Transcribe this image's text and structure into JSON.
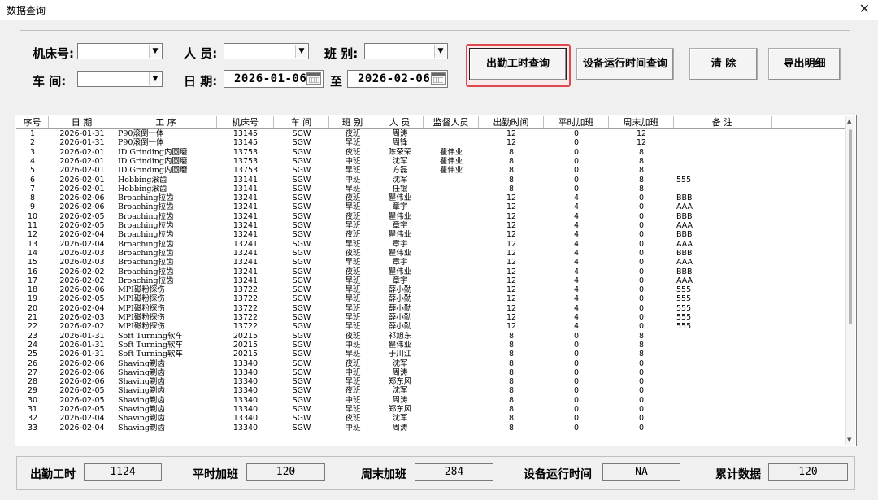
{
  "window": {
    "title": "数据查询",
    "close_glyph": "✕"
  },
  "filters": {
    "machine_label": "机床号:",
    "person_label": "人 员:",
    "shift_label": "班 别:",
    "workshop_label": "车 间:",
    "date_label": "日 期:",
    "to_label": "至",
    "machine_value": "",
    "person_value": "",
    "shift_value": "",
    "workshop_value": "",
    "date_from": "2026-01-06",
    "date_to": "2026-02-06"
  },
  "buttons": {
    "attendance_query": "出勤工时查询",
    "equipment_query": "设备运行时间查询",
    "clear": "清 除",
    "export": "导出明细"
  },
  "table": {
    "columns": [
      "序号",
      "日 期",
      "工 序",
      "机床号",
      "车 间",
      "班 别",
      "人 员",
      "监督人员",
      "出勤时间",
      "平时加班",
      "周末加班",
      "备 注"
    ],
    "rows": [
      [
        "1",
        "2026-01-31",
        "P90滚倒一体",
        "13145",
        "SGW",
        "夜班",
        "周涛",
        "",
        "12",
        "0",
        "12",
        ""
      ],
      [
        "2",
        "2026-01-31",
        "P90滚倒一体",
        "13145",
        "SGW",
        "早班",
        "周锋",
        "",
        "12",
        "0",
        "12",
        ""
      ],
      [
        "3",
        "2026-02-01",
        "ID Grinding内圆磨",
        "13753",
        "SGW",
        "夜班",
        "陈荣荣",
        "瞿伟业",
        "8",
        "0",
        "8",
        ""
      ],
      [
        "4",
        "2026-02-01",
        "ID Grinding内圆磨",
        "13753",
        "SGW",
        "中班",
        "沈军",
        "瞿伟业",
        "8",
        "0",
        "8",
        ""
      ],
      [
        "5",
        "2026-02-01",
        "ID Grinding内圆磨",
        "13753",
        "SGW",
        "早班",
        "方磊",
        "瞿伟业",
        "8",
        "0",
        "8",
        ""
      ],
      [
        "6",
        "2026-02-01",
        "Hobbing滚齿",
        "13141",
        "SGW",
        "中班",
        "沈军",
        "",
        "8",
        "0",
        "8",
        "555"
      ],
      [
        "7",
        "2026-02-01",
        "Hobbing滚齿",
        "13141",
        "SGW",
        "早班",
        "任银",
        "",
        "8",
        "0",
        "8",
        ""
      ],
      [
        "8",
        "2026-02-06",
        "Broaching拉齿",
        "13241",
        "SGW",
        "夜班",
        "瞿伟业",
        "",
        "12",
        "4",
        "0",
        "BBB"
      ],
      [
        "9",
        "2026-02-06",
        "Broaching拉齿",
        "13241",
        "SGW",
        "早班",
        "章宇",
        "",
        "12",
        "4",
        "0",
        "AAA"
      ],
      [
        "10",
        "2026-02-05",
        "Broaching拉齿",
        "13241",
        "SGW",
        "夜班",
        "瞿伟业",
        "",
        "12",
        "4",
        "0",
        "BBB"
      ],
      [
        "11",
        "2026-02-05",
        "Broaching拉齿",
        "13241",
        "SGW",
        "早班",
        "章宇",
        "",
        "12",
        "4",
        "0",
        "AAA"
      ],
      [
        "12",
        "2026-02-04",
        "Broaching拉齿",
        "13241",
        "SGW",
        "夜班",
        "瞿伟业",
        "",
        "12",
        "4",
        "0",
        "BBB"
      ],
      [
        "13",
        "2026-02-04",
        "Broaching拉齿",
        "13241",
        "SGW",
        "早班",
        "章宇",
        "",
        "12",
        "4",
        "0",
        "AAA"
      ],
      [
        "14",
        "2026-02-03",
        "Broaching拉齿",
        "13241",
        "SGW",
        "夜班",
        "瞿伟业",
        "",
        "12",
        "4",
        "0",
        "BBB"
      ],
      [
        "15",
        "2026-02-03",
        "Broaching拉齿",
        "13241",
        "SGW",
        "早班",
        "章宇",
        "",
        "12",
        "4",
        "0",
        "AAA"
      ],
      [
        "16",
        "2026-02-02",
        "Broaching拉齿",
        "13241",
        "SGW",
        "夜班",
        "瞿伟业",
        "",
        "12",
        "4",
        "0",
        "BBB"
      ],
      [
        "17",
        "2026-02-02",
        "Broaching拉齿",
        "13241",
        "SGW",
        "早班",
        "章宇",
        "",
        "12",
        "4",
        "0",
        "AAA"
      ],
      [
        "18",
        "2026-02-06",
        "MPI磁粉探伤",
        "13722",
        "SGW",
        "早班",
        "薛小勤",
        "",
        "12",
        "4",
        "0",
        "555"
      ],
      [
        "19",
        "2026-02-05",
        "MPI磁粉探伤",
        "13722",
        "SGW",
        "早班",
        "薛小勤",
        "",
        "12",
        "4",
        "0",
        "555"
      ],
      [
        "20",
        "2026-02-04",
        "MPI磁粉探伤",
        "13722",
        "SGW",
        "早班",
        "薛小勤",
        "",
        "12",
        "4",
        "0",
        "555"
      ],
      [
        "21",
        "2026-02-03",
        "MPI磁粉探伤",
        "13722",
        "SGW",
        "早班",
        "薛小勤",
        "",
        "12",
        "4",
        "0",
        "555"
      ],
      [
        "22",
        "2026-02-02",
        "MPI磁粉探伤",
        "13722",
        "SGW",
        "早班",
        "薛小勤",
        "",
        "12",
        "4",
        "0",
        "555"
      ],
      [
        "23",
        "2026-01-31",
        "Soft Turning软车",
        "20215",
        "SGW",
        "夜班",
        "祁旭东",
        "",
        "8",
        "0",
        "8",
        ""
      ],
      [
        "24",
        "2026-01-31",
        "Soft Turning软车",
        "20215",
        "SGW",
        "中班",
        "瞿伟业",
        "",
        "8",
        "0",
        "8",
        ""
      ],
      [
        "25",
        "2026-01-31",
        "Soft Turning软车",
        "20215",
        "SGW",
        "早班",
        "于川江",
        "",
        "8",
        "0",
        "8",
        ""
      ],
      [
        "26",
        "2026-02-06",
        "Shaving剃齿",
        "13340",
        "SGW",
        "夜班",
        "沈军",
        "",
        "8",
        "0",
        "0",
        ""
      ],
      [
        "27",
        "2026-02-06",
        "Shaving剃齿",
        "13340",
        "SGW",
        "中班",
        "周涛",
        "",
        "8",
        "0",
        "0",
        ""
      ],
      [
        "28",
        "2026-02-06",
        "Shaving剃齿",
        "13340",
        "SGW",
        "早班",
        "郑东风",
        "",
        "8",
        "0",
        "0",
        ""
      ],
      [
        "29",
        "2026-02-05",
        "Shaving剃齿",
        "13340",
        "SGW",
        "夜班",
        "沈军",
        "",
        "8",
        "0",
        "0",
        ""
      ],
      [
        "30",
        "2026-02-05",
        "Shaving剃齿",
        "13340",
        "SGW",
        "中班",
        "周涛",
        "",
        "8",
        "0",
        "0",
        ""
      ],
      [
        "31",
        "2026-02-05",
        "Shaving剃齿",
        "13340",
        "SGW",
        "早班",
        "郑东风",
        "",
        "8",
        "0",
        "0",
        ""
      ],
      [
        "32",
        "2026-02-04",
        "Shaving剃齿",
        "13340",
        "SGW",
        "夜班",
        "沈军",
        "",
        "8",
        "0",
        "0",
        ""
      ],
      [
        "33",
        "2026-02-04",
        "Shaving剃齿",
        "13340",
        "SGW",
        "中班",
        "周涛",
        "",
        "8",
        "0",
        "0",
        ""
      ]
    ]
  },
  "summary": {
    "attendance_label": "出勤工时",
    "attendance_value": "1124",
    "weekday_ot_label": "平时加班",
    "weekday_ot_value": "120",
    "weekend_ot_label": "周末加班",
    "weekend_ot_value": "284",
    "equipment_label": "设备运行时间",
    "equipment_value": "NA",
    "total_label": "累计数据",
    "total_value": "120"
  }
}
